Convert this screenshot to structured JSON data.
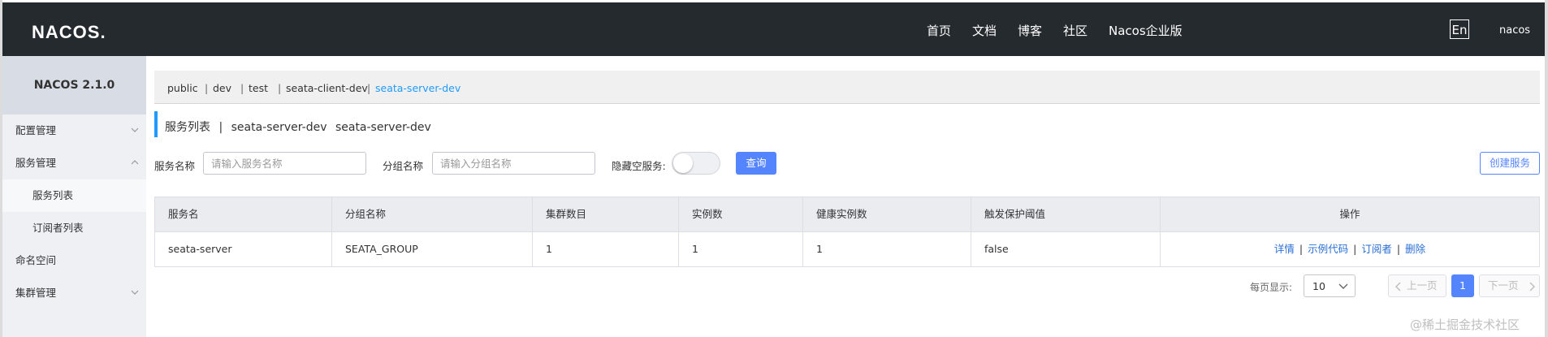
{
  "header": {
    "logo": "NACOS.",
    "nav": [
      "首页",
      "文档",
      "博客",
      "社区",
      "Nacos企业版"
    ],
    "lang_button": "En",
    "user": "nacos"
  },
  "sidebar": {
    "title": "NACOS 2.1.0",
    "items": [
      {
        "label": "配置管理",
        "chevron": "chevron-down-icon"
      },
      {
        "label": "服务管理",
        "chevron": "chevron-up-icon"
      },
      {
        "label": "服务列表",
        "active": true
      },
      {
        "label": "订阅者列表"
      },
      {
        "label": "命名空间"
      },
      {
        "label": "集群管理",
        "chevron": "chevron-down-icon"
      }
    ]
  },
  "namespaces": {
    "items": [
      "public",
      "dev",
      "test",
      "seata-client-dev",
      "seata-server-dev"
    ],
    "separator": "|",
    "active": "seata-server-dev"
  },
  "page": {
    "title": "服务列表",
    "separator": "|",
    "namespace_name": "seata-server-dev",
    "namespace_id": "seata-server-dev"
  },
  "filters": {
    "service_name_label": "服务名称",
    "service_name_placeholder": "请输入服务名称",
    "group_name_label": "分组名称",
    "group_name_placeholder": "请输入分组名称",
    "hide_empty_label": "隐藏空服务:",
    "hide_empty_value": false,
    "query_button": "查询",
    "create_button": "创建服务"
  },
  "table": {
    "columns": [
      "服务名",
      "分组名称",
      "集群数目",
      "实例数",
      "健康实例数",
      "触发保护阈值",
      "操作"
    ],
    "rows": [
      {
        "service": "seata-server",
        "group": "SEATA_GROUP",
        "clusters": "1",
        "instances": "1",
        "healthy": "1",
        "threshold": "false",
        "ops": [
          "详情",
          "示例代码",
          "订阅者",
          "删除"
        ]
      }
    ],
    "op_separator": "|"
  },
  "pagination": {
    "page_size_label": "每页显示:",
    "page_size": "10",
    "prev": "上一页",
    "current": "1",
    "next": "下一页"
  },
  "watermark": "@稀土掘金技术社区",
  "colors": {
    "topbar": "#252a2f",
    "accent": "#209bfa",
    "primary_button": "#5584ff",
    "link": "#2a6fd6"
  }
}
